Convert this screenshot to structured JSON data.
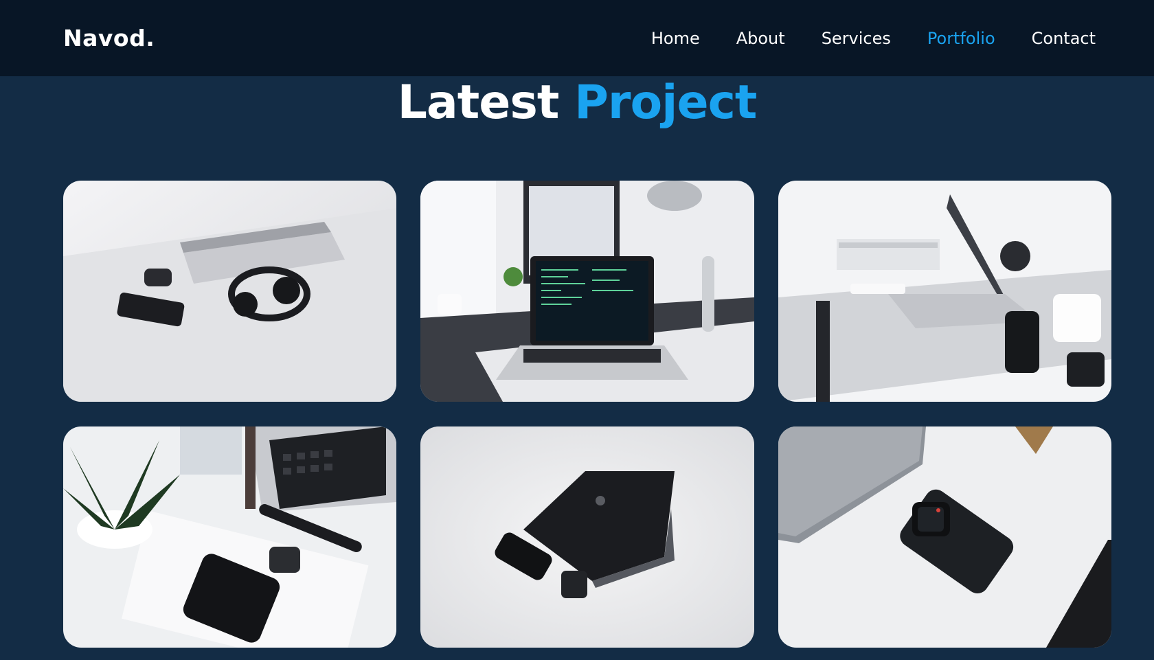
{
  "brand": {
    "logo": "Navod."
  },
  "nav": {
    "items": [
      {
        "label": "Home",
        "active": false
      },
      {
        "label": "About",
        "active": false
      },
      {
        "label": "Services",
        "active": false
      },
      {
        "label": "Portfolio",
        "active": true
      },
      {
        "label": "Contact",
        "active": false
      }
    ]
  },
  "section": {
    "title_main": "Latest",
    "title_accent": "Project"
  },
  "colors": {
    "background": "#132c45",
    "navbar": "#081626",
    "accent": "#1aa3f0",
    "text": "#ffffff"
  },
  "projects": [
    {
      "image": "desk-laptop-headphones-phone-watch-photo"
    },
    {
      "image": "desk-monitor-laptop-code-photo"
    },
    {
      "image": "desk-laptop-books-camera-lens-photo"
    },
    {
      "image": "laptop-plant-watch-phone-photo"
    },
    {
      "image": "black-laptop-phone-watch-photo"
    },
    {
      "image": "laptop-smartwatch-phone-photo"
    }
  ]
}
